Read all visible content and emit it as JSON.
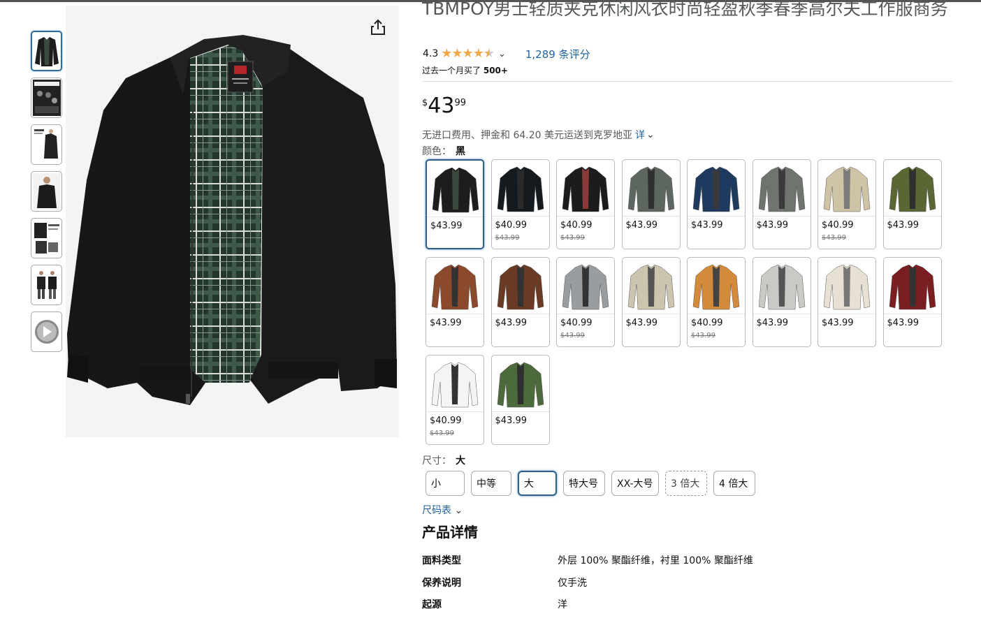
{
  "product": {
    "title": "TBMPOY男士轻质夹克休闲风衣时尚轻盈秋季春季高尔夫工作服商务",
    "rating": "4.3",
    "reviews": "1,289 条评分",
    "bought_prefix": "过去一个月买了",
    "bought_count": "500+",
    "price_symbol": "$",
    "price_whole": "43",
    "price_fraction": "99",
    "shipping": "无进口费用、押金和 64.20 美元运送到克罗地亚",
    "shipping_link": "详",
    "color_label": "颜色：",
    "color_value": "黑"
  },
  "colors": [
    {
      "price": "$43.99",
      "old": "",
      "color": "#1d1d1d",
      "lining": "#3b4a3f",
      "selected": true
    },
    {
      "price": "$40.99",
      "old": "$43.99",
      "color": "#151a1e",
      "lining": "#2a2a2a"
    },
    {
      "price": "$40.99",
      "old": "$43.99",
      "color": "#1c1c1c",
      "lining": "#8a3a3a"
    },
    {
      "price": "$43.99",
      "old": "",
      "color": "#5e6660",
      "lining": "#2f2f2f"
    },
    {
      "price": "$43.99",
      "old": "",
      "color": "#1e3a5f",
      "lining": "#3a3a3a"
    },
    {
      "price": "$43.99",
      "old": "",
      "color": "#70746f",
      "lining": "#3a3a3a"
    },
    {
      "price": "$40.99",
      "old": "$43.99",
      "color": "#cfc3a5",
      "lining": "#7b7b7b"
    },
    {
      "price": "$43.99",
      "old": "",
      "color": "#5a6634",
      "lining": "#2f2f2f"
    },
    {
      "price": "$43.99",
      "old": "",
      "color": "#8b4a2b",
      "lining": "#333"
    },
    {
      "price": "$43.99",
      "old": "",
      "color": "#6b3a24",
      "lining": "#333"
    },
    {
      "price": "$40.99",
      "old": "$43.99",
      "color": "#9a9da0",
      "lining": "#333"
    },
    {
      "price": "$43.99",
      "old": "",
      "color": "#cbc4ae",
      "lining": "#555"
    },
    {
      "price": "$40.99",
      "old": "$43.99",
      "color": "#d38a3a",
      "lining": "#444"
    },
    {
      "price": "$43.99",
      "old": "",
      "color": "#c8cbc5",
      "lining": "#555"
    },
    {
      "price": "$43.99",
      "old": "",
      "color": "#e6e1d2",
      "lining": "#777"
    },
    {
      "price": "$43.99",
      "old": "",
      "color": "#7a1e22",
      "lining": "#333"
    },
    {
      "price": "$40.99",
      "old": "$43.99",
      "color": "#f4f4f2",
      "lining": "#333"
    },
    {
      "price": "$43.99",
      "old": "",
      "color": "#4c6a3c",
      "lining": "#2f2f2f"
    }
  ],
  "size": {
    "label": "尺寸：",
    "value": "大",
    "options": [
      "小",
      "中等",
      "大",
      "特大号",
      "XX-大号",
      "3 倍大",
      "4 倍大"
    ],
    "selected_index": 2,
    "dashed_index": 5,
    "chart_link": "尺码表"
  },
  "details": {
    "heading": "产品详情",
    "rows": [
      {
        "key": "面料类型",
        "value": "外层 100% 聚酯纤维，衬里 100% 聚酯纤维"
      },
      {
        "key": "保养说明",
        "value": "仅手洗"
      },
      {
        "key": "起源",
        "value": "洋"
      }
    ]
  },
  "icons": [
    "share-icon",
    "chevron-down-icon",
    "star-icon"
  ]
}
